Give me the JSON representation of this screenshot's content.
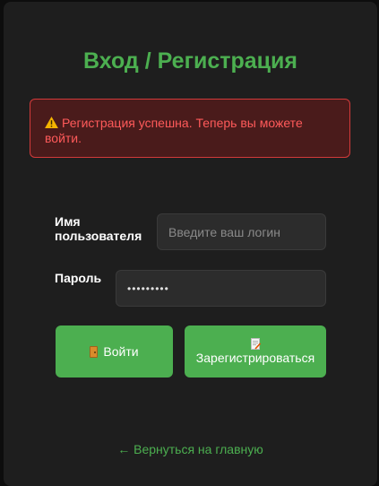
{
  "page": {
    "title": "Вход / Регистрация"
  },
  "alert": {
    "icon": "warning-icon",
    "message": "Регистрация успешна. Теперь вы можете войти.",
    "color": "#ff5a5a"
  },
  "form": {
    "username_label": "Имя пользователя",
    "username_placeholder": "Введите ваш логин",
    "password_label": "Пароль",
    "password_value": "•••••••••"
  },
  "buttons": {
    "login_label": "Войти",
    "login_icon": "door-icon",
    "register_label": "Зарегистрироваться",
    "register_icon": "memo-icon",
    "accent_color": "#4caf50"
  },
  "footer": {
    "back_link": "← Вернуться на главную"
  }
}
